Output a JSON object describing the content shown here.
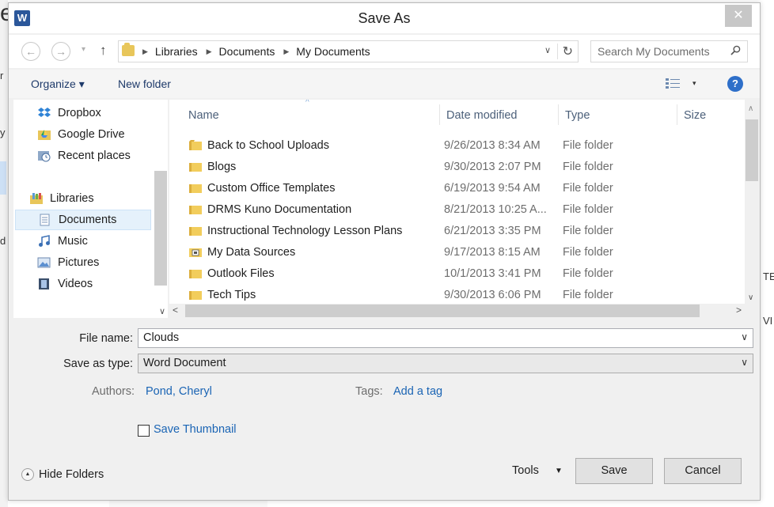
{
  "dialog": {
    "title": "Save As",
    "close_glyph": "✕"
  },
  "background_fragments": [
    "e",
    "r",
    "y",
    "d",
    "TE",
    "VI"
  ],
  "nav": {
    "back_glyph": "←",
    "forward_glyph": "→",
    "history_glyph": "▾",
    "up_glyph": "↑",
    "breadcrumbs": [
      "Libraries",
      "Documents",
      "My Documents"
    ],
    "refresh_glyph": "↻",
    "search_placeholder": "Search My Documents"
  },
  "toolbar": {
    "organize": "Organize ▾",
    "new_folder": "New folder",
    "view_dd": "▾",
    "help": "?"
  },
  "nav_pane": {
    "items": [
      {
        "label": "Dropbox",
        "icon": "dropbox-icon"
      },
      {
        "label": "Google Drive",
        "icon": "google-drive-icon"
      },
      {
        "label": "Recent places",
        "icon": "recent-places-icon"
      },
      {
        "label": "Libraries",
        "icon": "libraries-icon"
      },
      {
        "label": "Documents",
        "icon": "documents-icon",
        "selected": true
      },
      {
        "label": "Music",
        "icon": "music-icon"
      },
      {
        "label": "Pictures",
        "icon": "pictures-icon"
      },
      {
        "label": "Videos",
        "icon": "videos-icon"
      }
    ]
  },
  "file_list": {
    "columns": [
      "Name",
      "Date modified",
      "Type",
      "Size"
    ],
    "sort_arrow": "^",
    "rows": [
      {
        "name": "Back to School Uploads",
        "date": "9/26/2013 8:34 AM",
        "type": "File folder",
        "icon": "folder-icon"
      },
      {
        "name": "Blogs",
        "date": "9/30/2013 2:07 PM",
        "type": "File folder",
        "icon": "folder-icon"
      },
      {
        "name": "Custom Office Templates",
        "date": "6/19/2013 9:54 AM",
        "type": "File folder",
        "icon": "folder-icon"
      },
      {
        "name": "DRMS Kuno Documentation",
        "date": "8/21/2013 10:25 A...",
        "type": "File folder",
        "icon": "folder-icon"
      },
      {
        "name": "Instructional Technology Lesson Plans",
        "date": "6/21/2013 3:35 PM",
        "type": "File folder",
        "icon": "folder-icon"
      },
      {
        "name": "My Data Sources",
        "date": "9/17/2013 8:15 AM",
        "type": "File folder",
        "icon": "data-sources-folder-icon"
      },
      {
        "name": "Outlook Files",
        "date": "10/1/2013 3:41 PM",
        "type": "File folder",
        "icon": "folder-icon"
      },
      {
        "name": "Tech Tips",
        "date": "9/30/2013 6:06 PM",
        "type": "File folder",
        "icon": "folder-icon"
      }
    ]
  },
  "form": {
    "file_name_label": "File name:",
    "file_name_value": "Clouds",
    "save_type_label": "Save as type:",
    "save_type_value": "Word Document",
    "dd_glyph": "∨",
    "authors_label": "Authors:",
    "authors_value": "Pond, Cheryl",
    "tags_label": "Tags:",
    "tags_value": "Add a tag",
    "thumbnail_label": "Save Thumbnail"
  },
  "footer": {
    "hide_folders": "Hide Folders",
    "hide_glyph": "▲",
    "tools": "Tools",
    "tools_dd": "▼",
    "save": "Save",
    "cancel": "Cancel"
  },
  "colors": {
    "accent_link": "#1a64b4",
    "folder_yellow": "#e8c65a",
    "selection": "#e5f1fb",
    "help_blue": "#2e6fc9",
    "word_blue": "#2b579a"
  }
}
